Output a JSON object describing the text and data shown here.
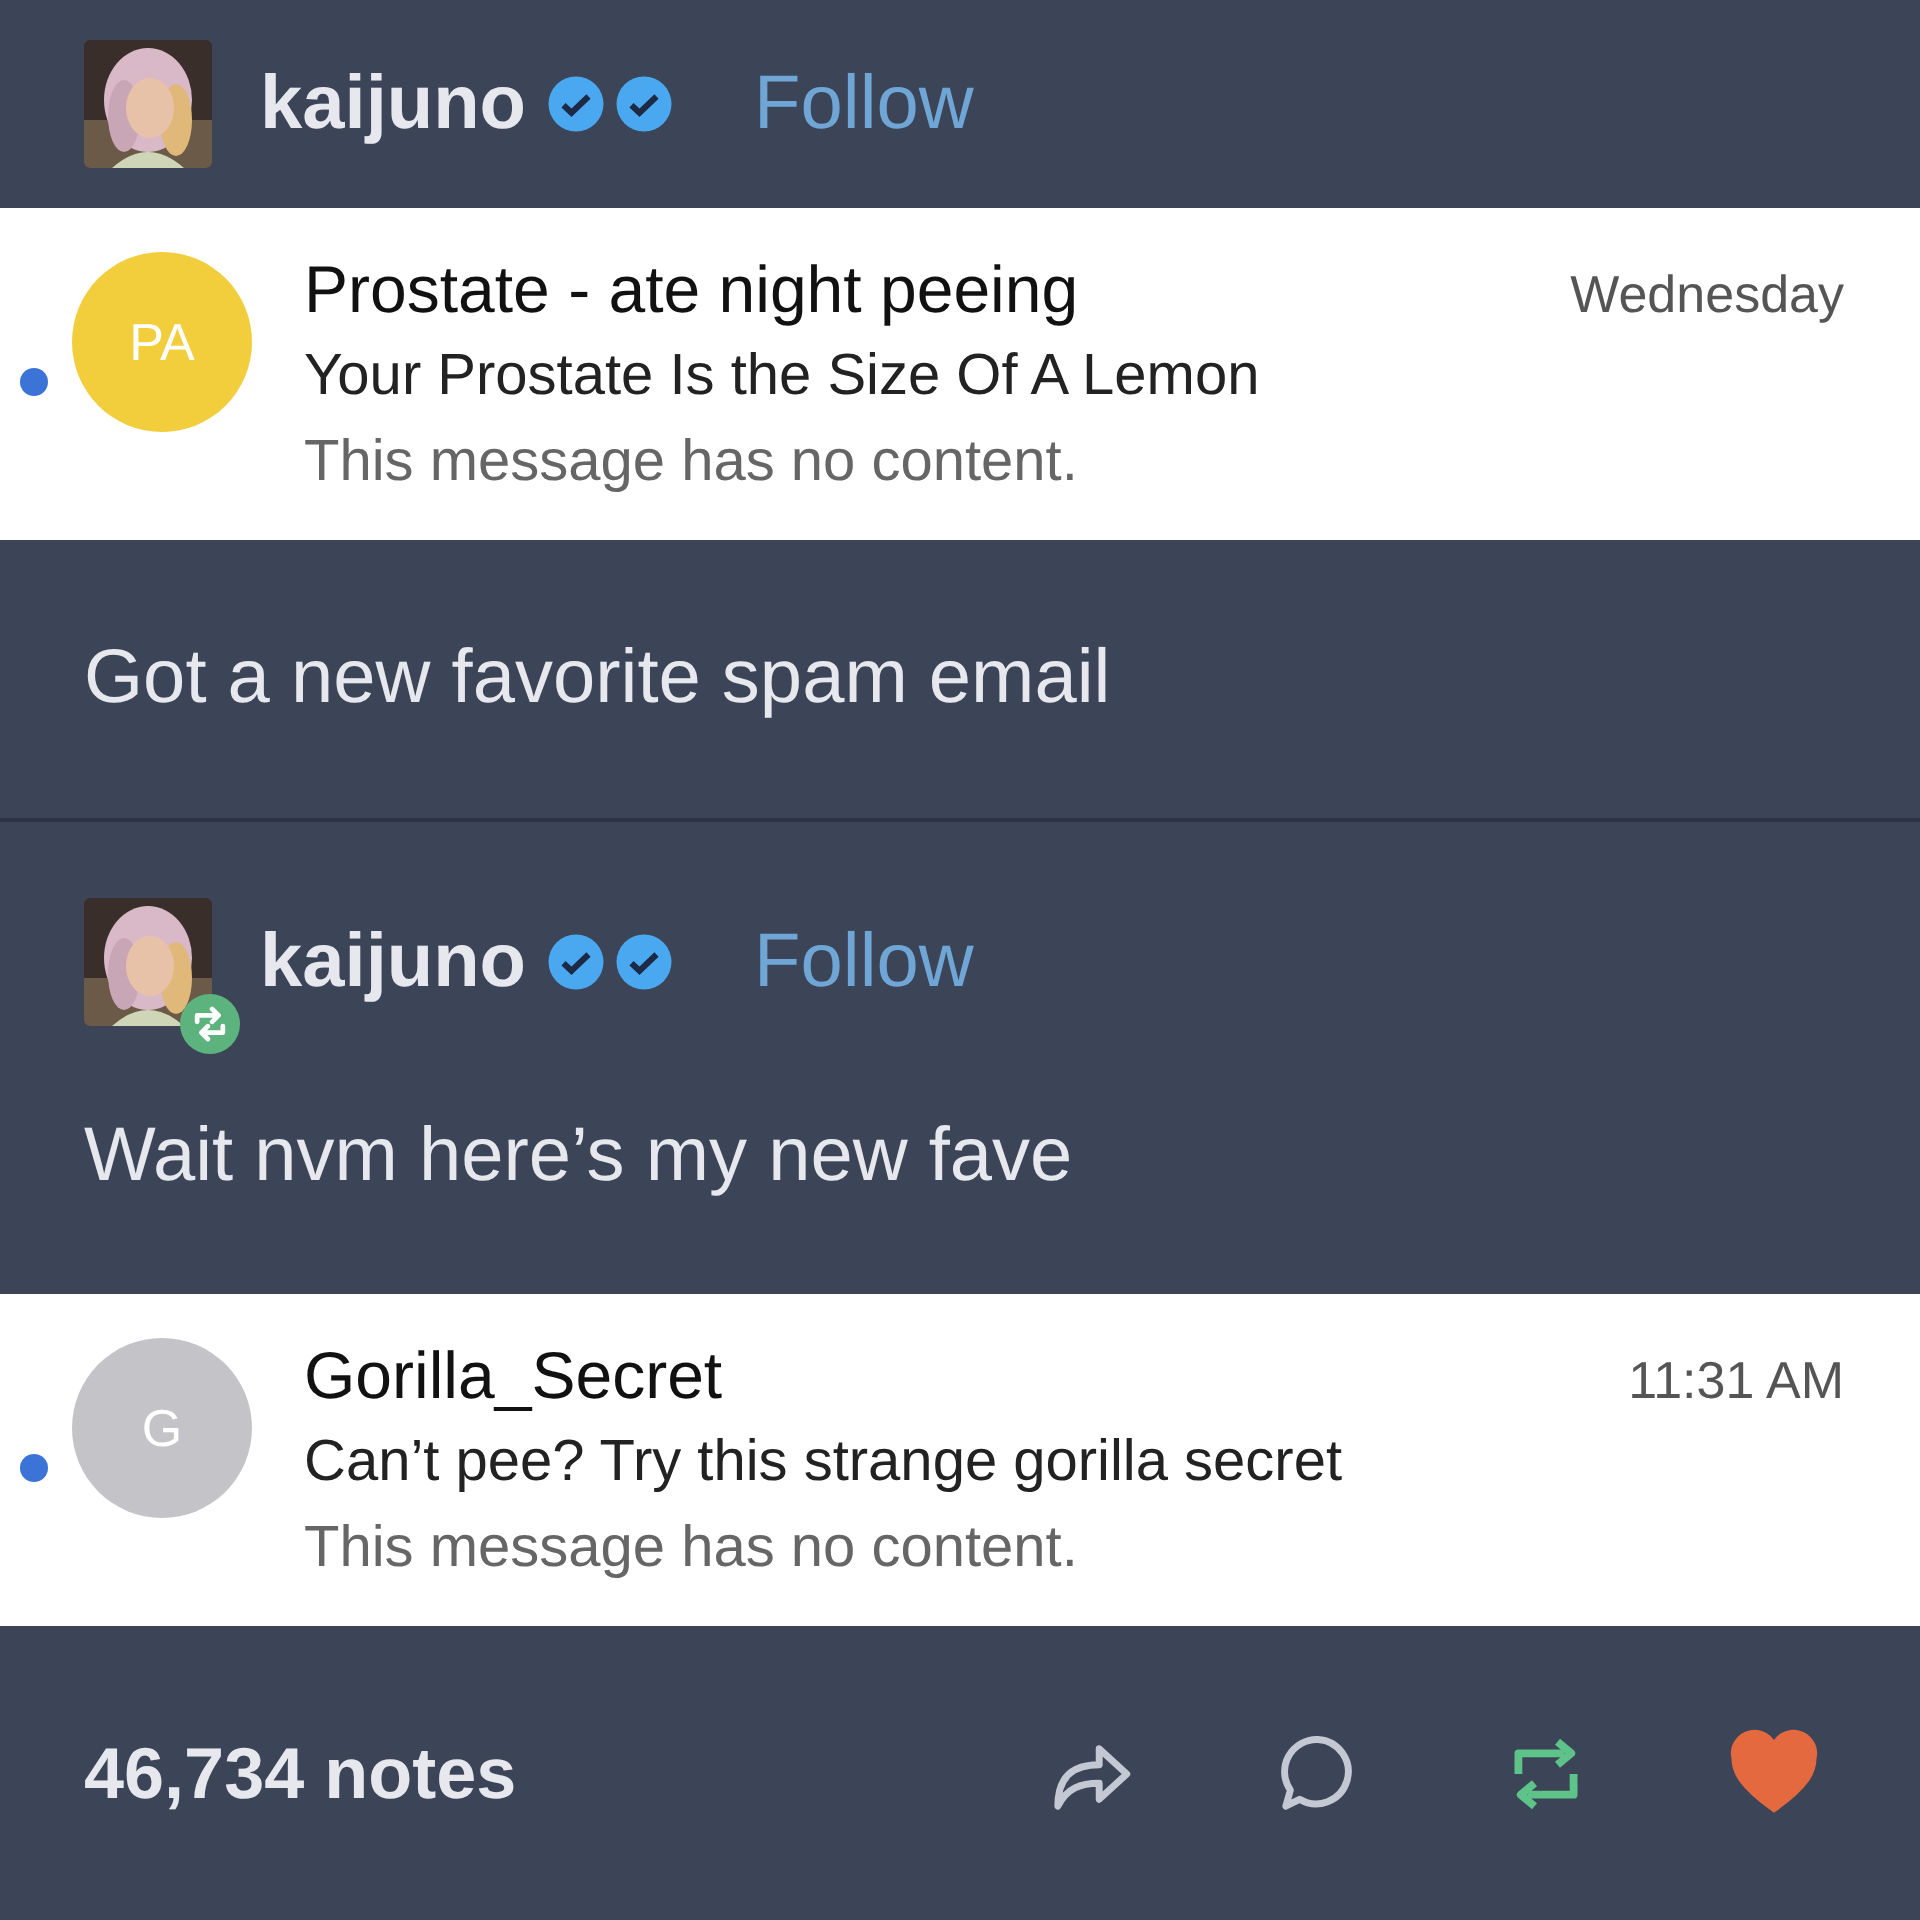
{
  "blocks": [
    {
      "kind": "author",
      "name": "kaijuno",
      "follow": "Follow",
      "reblog": false
    },
    {
      "kind": "email",
      "unread": true,
      "initials": "PA",
      "color": "#f2cd3c",
      "sender": "Prostate - ate night peeing",
      "time": "Wednesday",
      "subject": "Your Prostate Is the Size Of A Lemon",
      "preview": "This message has no content."
    },
    {
      "kind": "text",
      "text": "Got a new favorite spam email"
    },
    {
      "kind": "author",
      "name": "kaijuno",
      "follow": "Follow",
      "reblog": true
    },
    {
      "kind": "text",
      "text": "Wait nvm here’s my new fave"
    },
    {
      "kind": "email",
      "unread": true,
      "initials": "G",
      "color": "#c4c4c8",
      "sender": "Gorilla_Secret",
      "time": "11:31 AM",
      "subject": "Can’t pee? Try this strange gorilla secret",
      "preview": "This message has no content."
    }
  ],
  "footer": {
    "notes": "46,734 notes",
    "reblogged": true,
    "liked": true
  }
}
